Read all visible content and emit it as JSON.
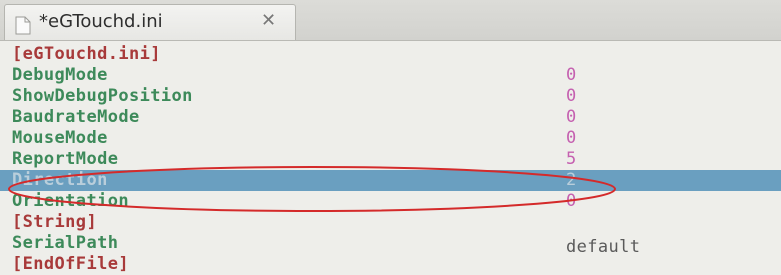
{
  "tab": {
    "title": "*eGTouchd.ini",
    "close_glyph": "✕",
    "icon": "document-icon",
    "close_icon": "close-icon"
  },
  "editor": {
    "lines": [
      {
        "key": "[eGTouchd.ini]",
        "value": "",
        "kind": "section"
      },
      {
        "key": "DebugMode",
        "value": "0",
        "kind": "key"
      },
      {
        "key": "ShowDebugPosition",
        "value": "0",
        "kind": "key"
      },
      {
        "key": "BaudrateMode",
        "value": "0",
        "kind": "key"
      },
      {
        "key": "MouseMode",
        "value": "0",
        "kind": "key"
      },
      {
        "key": "ReportMode",
        "value": "5",
        "kind": "key"
      },
      {
        "key": "Direction",
        "value": "2",
        "kind": "key",
        "current": true
      },
      {
        "key": "Orientation",
        "value": "0",
        "kind": "key"
      },
      {
        "key": "[String]",
        "value": "",
        "kind": "section"
      },
      {
        "key": "SerialPath",
        "value": "default",
        "kind": "key-string"
      },
      {
        "key": "[EndOfFile]",
        "value": "",
        "kind": "section"
      }
    ]
  },
  "colors": {
    "section": "#a83a3a",
    "key": "#3d8a5a",
    "number": "#c560b0",
    "string": "#5a5a5a",
    "current_line_bg": "#6a9fc0",
    "current_line_text": "#b9cedb",
    "annotation_circle": "#d42a2a"
  }
}
